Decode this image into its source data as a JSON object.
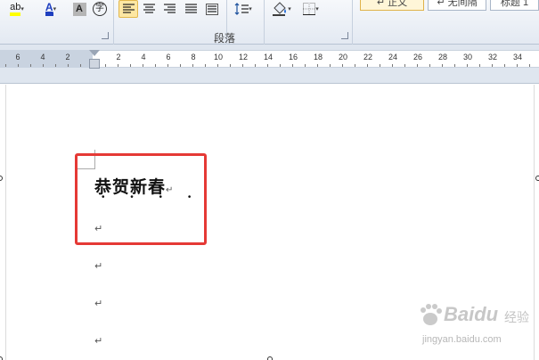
{
  "ribbon": {
    "font_tools": {
      "highlight": "ab",
      "font_color": "A",
      "char_shading": "A",
      "enclose_char": "字"
    },
    "paragraph_group_label": "段落",
    "styles": {
      "normal": "↵ 正文",
      "no_spacing": "↵ 无间隔",
      "heading1": "标题 1"
    }
  },
  "ruler": {
    "labels": [
      "6",
      "4",
      "2",
      "2",
      "4",
      "6",
      "8",
      "10",
      "12",
      "14",
      "16",
      "18",
      "20",
      "22",
      "24",
      "26",
      "28",
      "30",
      "32",
      "34"
    ]
  },
  "document": {
    "heading": "恭贺新春",
    "heading_mark": "↵",
    "emphasis_dots": "• • • •",
    "empty_paragraphs": [
      "↵",
      "↵",
      "↵",
      "↵"
    ]
  },
  "watermark": {
    "brand": "Baidu",
    "cn": "经验",
    "url": "jingyan.baidu.com"
  },
  "colors": {
    "highlight_box": "#e53935",
    "ribbon_active": "#fde7a3"
  }
}
